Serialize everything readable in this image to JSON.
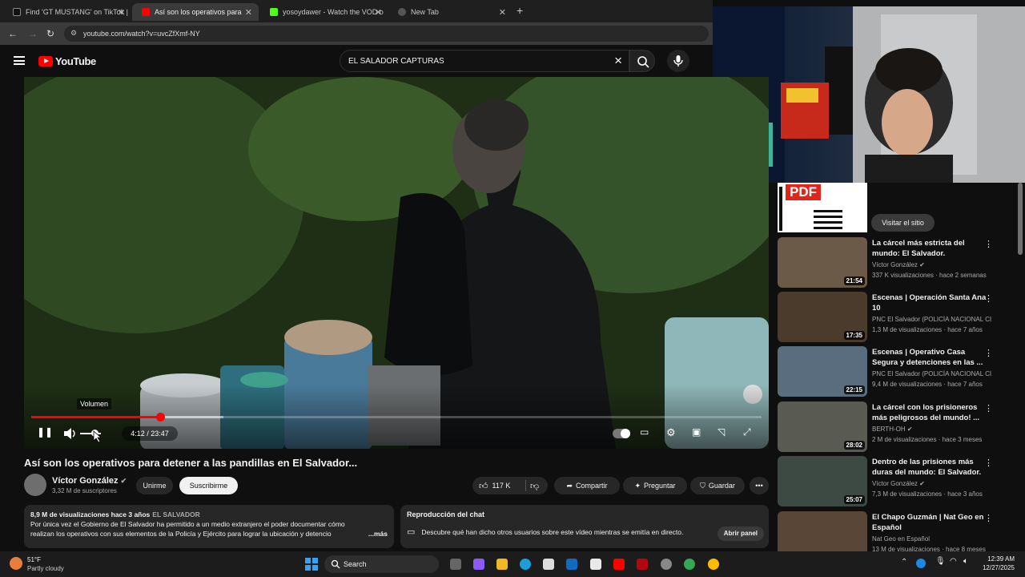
{
  "tabs": [
    {
      "title": "Find 'GT MUSTANG' on TikTok |",
      "active": false
    },
    {
      "title": "Así son los operativos para",
      "active": true
    },
    {
      "title": "yosoydawer - Watch the VOD o",
      "active": false
    },
    {
      "title": "New Tab",
      "active": false
    }
  ],
  "address": {
    "url": "youtube.com/watch?v=uvcZfXmf-NY"
  },
  "youtube": {
    "logo_text": "YouTube",
    "search_query": "EL SALADOR CAPTURAS"
  },
  "player": {
    "volume_tooltip": "Volumen",
    "time": "4:12 / 23:47",
    "progress_played": 0.177,
    "progress_buffered": 0.263
  },
  "video": {
    "title": "Así son los operativos para detener a las pandillas en El Salvador...",
    "channel": "Víctor González",
    "subscribers": "3,32 M de suscriptores",
    "join_label": "Unirme",
    "subscribe_label": "Suscribirme",
    "likes": "117 K",
    "share_label": "Compartir",
    "ask_label": "Preguntar",
    "save_label": "Guardar"
  },
  "description": {
    "meta": "8,9 M de visualizaciones  hace 3 años",
    "tag": "EL SALVADOR",
    "line1": "Por única vez el Gobierno de El Salvador ha permitido a un medio extranjero el poder documentar cómo",
    "line2": "realizan los operativos con sus elementos de la Policía y Ejército para lograr la ubicación y detencio",
    "more": "...más"
  },
  "chat_replay": {
    "heading": "Reproducción del chat",
    "text": "Descubre qué han dicho otros usuarios sobre este vídeo mientras se emitía en directo.",
    "button": "Abrir panel"
  },
  "ad": {
    "thumb_text": "PDF",
    "button": "Visitar el sitio"
  },
  "related": [
    {
      "title": "La cárcel más estricta del mundo: El Salvador.",
      "channel": "Víctor González",
      "verified": true,
      "stats": "337 K visualizaciones · hace 2 semanas",
      "duration": "21:54"
    },
    {
      "title": "Escenas | Operación Santa Ana 10",
      "channel": "PNC El Salvador (POLICÍA NACIONAL CI...",
      "verified": false,
      "stats": "1,3 M de visualizaciones · hace 7 años",
      "duration": "17:35"
    },
    {
      "title": "Escenas | Operativo Casa Segura  y detenciones en las ...",
      "channel": "PNC El Salvador (POLICÍA NACIONAL CI...",
      "verified": false,
      "stats": "9,4 M de visualizaciones · hace 7 años",
      "duration": "22:15"
    },
    {
      "title": "La cárcel con los prisioneros más peligrosos del mundo! ...",
      "channel": "BERTH-OH",
      "verified": true,
      "stats": "2 M de visualizaciones · hace 3 meses",
      "duration": "28:02"
    },
    {
      "title": "Dentro de las prisiones más duras del mundo: El Salvador.",
      "channel": "Víctor González",
      "verified": true,
      "stats": "7,3 M de visualizaciones · hace 3 años",
      "duration": "25:07"
    },
    {
      "title": "El Chapo Guzmán | Nat Geo en Español",
      "channel": "Nat Geo en Español",
      "verified": false,
      "stats": "13 M de visualizaciones · hace 8 meses",
      "duration": ""
    }
  ],
  "taskbar": {
    "weather_temp": "51°F",
    "weather_desc": "Partly cloudy",
    "search_label": "Search",
    "time": "12:39 AM",
    "date": "12/27/2025"
  },
  "colors": {
    "accent": "#ff0000",
    "background": "#0f0f0f",
    "chip": "#272727"
  }
}
